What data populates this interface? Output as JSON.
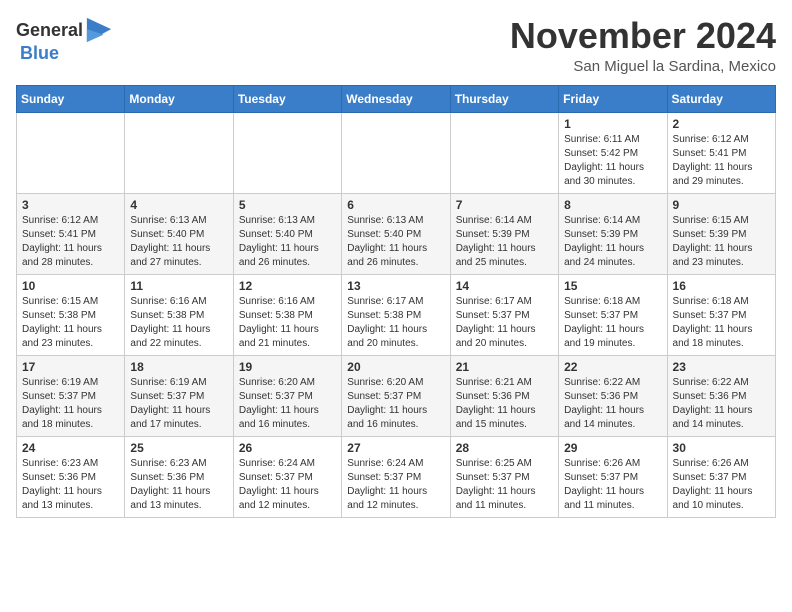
{
  "logo": {
    "general": "General",
    "blue": "Blue"
  },
  "header": {
    "month": "November 2024",
    "location": "San Miguel la Sardina, Mexico"
  },
  "weekdays": [
    "Sunday",
    "Monday",
    "Tuesday",
    "Wednesday",
    "Thursday",
    "Friday",
    "Saturday"
  ],
  "weeks": [
    [
      {
        "day": "",
        "info": ""
      },
      {
        "day": "",
        "info": ""
      },
      {
        "day": "",
        "info": ""
      },
      {
        "day": "",
        "info": ""
      },
      {
        "day": "",
        "info": ""
      },
      {
        "day": "1",
        "info": "Sunrise: 6:11 AM\nSunset: 5:42 PM\nDaylight: 11 hours and 30 minutes."
      },
      {
        "day": "2",
        "info": "Sunrise: 6:12 AM\nSunset: 5:41 PM\nDaylight: 11 hours and 29 minutes."
      }
    ],
    [
      {
        "day": "3",
        "info": "Sunrise: 6:12 AM\nSunset: 5:41 PM\nDaylight: 11 hours and 28 minutes."
      },
      {
        "day": "4",
        "info": "Sunrise: 6:13 AM\nSunset: 5:40 PM\nDaylight: 11 hours and 27 minutes."
      },
      {
        "day": "5",
        "info": "Sunrise: 6:13 AM\nSunset: 5:40 PM\nDaylight: 11 hours and 26 minutes."
      },
      {
        "day": "6",
        "info": "Sunrise: 6:13 AM\nSunset: 5:40 PM\nDaylight: 11 hours and 26 minutes."
      },
      {
        "day": "7",
        "info": "Sunrise: 6:14 AM\nSunset: 5:39 PM\nDaylight: 11 hours and 25 minutes."
      },
      {
        "day": "8",
        "info": "Sunrise: 6:14 AM\nSunset: 5:39 PM\nDaylight: 11 hours and 24 minutes."
      },
      {
        "day": "9",
        "info": "Sunrise: 6:15 AM\nSunset: 5:39 PM\nDaylight: 11 hours and 23 minutes."
      }
    ],
    [
      {
        "day": "10",
        "info": "Sunrise: 6:15 AM\nSunset: 5:38 PM\nDaylight: 11 hours and 23 minutes."
      },
      {
        "day": "11",
        "info": "Sunrise: 6:16 AM\nSunset: 5:38 PM\nDaylight: 11 hours and 22 minutes."
      },
      {
        "day": "12",
        "info": "Sunrise: 6:16 AM\nSunset: 5:38 PM\nDaylight: 11 hours and 21 minutes."
      },
      {
        "day": "13",
        "info": "Sunrise: 6:17 AM\nSunset: 5:38 PM\nDaylight: 11 hours and 20 minutes."
      },
      {
        "day": "14",
        "info": "Sunrise: 6:17 AM\nSunset: 5:37 PM\nDaylight: 11 hours and 20 minutes."
      },
      {
        "day": "15",
        "info": "Sunrise: 6:18 AM\nSunset: 5:37 PM\nDaylight: 11 hours and 19 minutes."
      },
      {
        "day": "16",
        "info": "Sunrise: 6:18 AM\nSunset: 5:37 PM\nDaylight: 11 hours and 18 minutes."
      }
    ],
    [
      {
        "day": "17",
        "info": "Sunrise: 6:19 AM\nSunset: 5:37 PM\nDaylight: 11 hours and 18 minutes."
      },
      {
        "day": "18",
        "info": "Sunrise: 6:19 AM\nSunset: 5:37 PM\nDaylight: 11 hours and 17 minutes."
      },
      {
        "day": "19",
        "info": "Sunrise: 6:20 AM\nSunset: 5:37 PM\nDaylight: 11 hours and 16 minutes."
      },
      {
        "day": "20",
        "info": "Sunrise: 6:20 AM\nSunset: 5:37 PM\nDaylight: 11 hours and 16 minutes."
      },
      {
        "day": "21",
        "info": "Sunrise: 6:21 AM\nSunset: 5:36 PM\nDaylight: 11 hours and 15 minutes."
      },
      {
        "day": "22",
        "info": "Sunrise: 6:22 AM\nSunset: 5:36 PM\nDaylight: 11 hours and 14 minutes."
      },
      {
        "day": "23",
        "info": "Sunrise: 6:22 AM\nSunset: 5:36 PM\nDaylight: 11 hours and 14 minutes."
      }
    ],
    [
      {
        "day": "24",
        "info": "Sunrise: 6:23 AM\nSunset: 5:36 PM\nDaylight: 11 hours and 13 minutes."
      },
      {
        "day": "25",
        "info": "Sunrise: 6:23 AM\nSunset: 5:36 PM\nDaylight: 11 hours and 13 minutes."
      },
      {
        "day": "26",
        "info": "Sunrise: 6:24 AM\nSunset: 5:37 PM\nDaylight: 11 hours and 12 minutes."
      },
      {
        "day": "27",
        "info": "Sunrise: 6:24 AM\nSunset: 5:37 PM\nDaylight: 11 hours and 12 minutes."
      },
      {
        "day": "28",
        "info": "Sunrise: 6:25 AM\nSunset: 5:37 PM\nDaylight: 11 hours and 11 minutes."
      },
      {
        "day": "29",
        "info": "Sunrise: 6:26 AM\nSunset: 5:37 PM\nDaylight: 11 hours and 11 minutes."
      },
      {
        "day": "30",
        "info": "Sunrise: 6:26 AM\nSunset: 5:37 PM\nDaylight: 11 hours and 10 minutes."
      }
    ]
  ]
}
